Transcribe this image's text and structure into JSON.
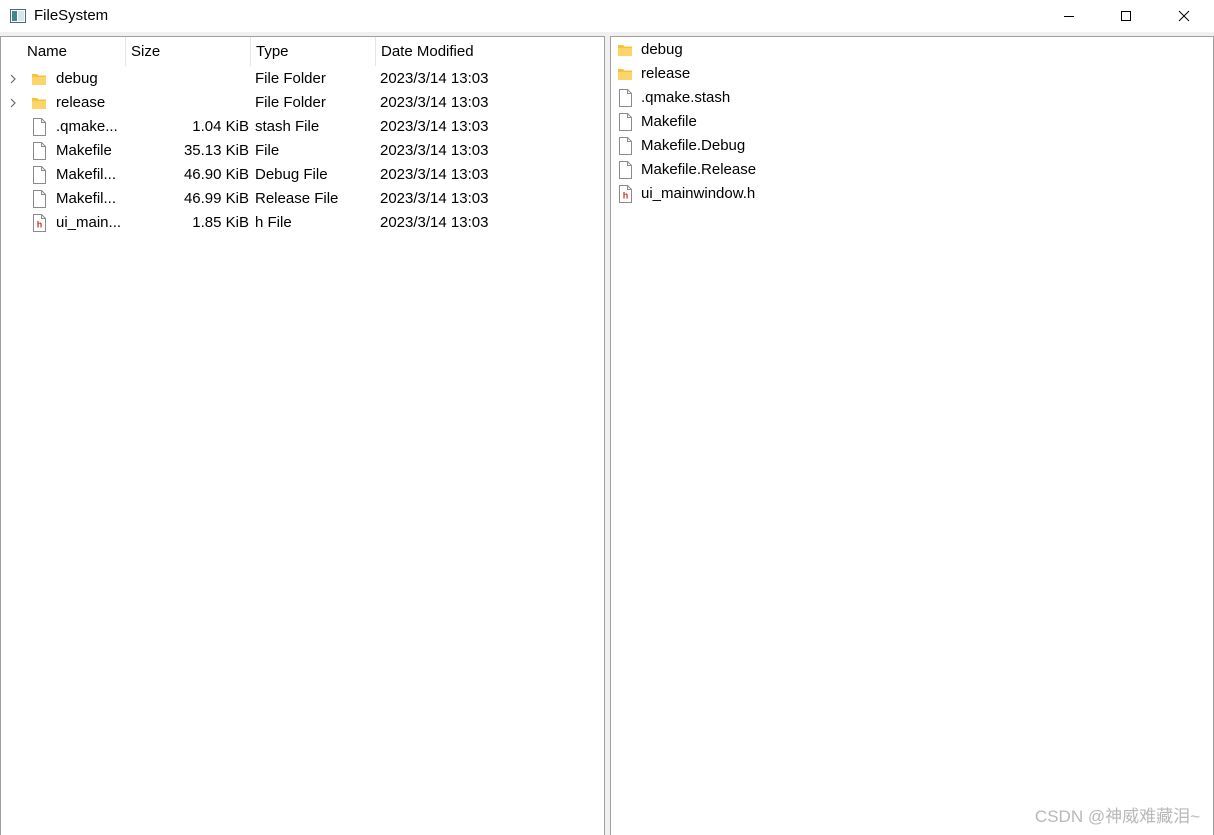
{
  "window": {
    "title": "FileSystem"
  },
  "tree": {
    "headers": {
      "name": "Name",
      "size": "Size",
      "type": "Type",
      "date": "Date Modified"
    },
    "rows": [
      {
        "name": "debug",
        "size": "",
        "type": "File Folder",
        "date": "2023/3/14 13:03",
        "icon": "folder-icon",
        "expandable": true
      },
      {
        "name": "release",
        "size": "",
        "type": "File Folder",
        "date": "2023/3/14 13:03",
        "icon": "folder-icon",
        "expandable": true
      },
      {
        "name": ".qmake...",
        "size": "1.04 KiB",
        "type": "stash File",
        "date": "2023/3/14 13:03",
        "icon": "file-icon",
        "expandable": false
      },
      {
        "name": "Makefile",
        "size": "35.13 KiB",
        "type": "File",
        "date": "2023/3/14 13:03",
        "icon": "file-icon",
        "expandable": false
      },
      {
        "name": "Makefil...",
        "size": "46.90 KiB",
        "type": "Debug File",
        "date": "2023/3/14 13:03",
        "icon": "file-icon",
        "expandable": false
      },
      {
        "name": "Makefil...",
        "size": "46.99 KiB",
        "type": "Release File",
        "date": "2023/3/14 13:03",
        "icon": "file-icon",
        "expandable": false
      },
      {
        "name": "ui_main...",
        "size": "1.85 KiB",
        "type": "h File",
        "date": "2023/3/14 13:03",
        "icon": "header-file-icon",
        "expandable": false
      }
    ]
  },
  "list": {
    "items": [
      {
        "name": "debug",
        "icon": "folder-icon"
      },
      {
        "name": "release",
        "icon": "folder-icon"
      },
      {
        "name": ".qmake.stash",
        "icon": "file-icon"
      },
      {
        "name": "Makefile",
        "icon": "file-icon"
      },
      {
        "name": "Makefile.Debug",
        "icon": "file-icon"
      },
      {
        "name": "Makefile.Release",
        "icon": "file-icon"
      },
      {
        "name": "ui_mainwindow.h",
        "icon": "header-file-icon"
      }
    ]
  },
  "watermark": "CSDN @神威难藏泪~",
  "colors": {
    "folder": "#f5c33b",
    "header_file": "#c0392b",
    "border": "#a0a0a0"
  }
}
